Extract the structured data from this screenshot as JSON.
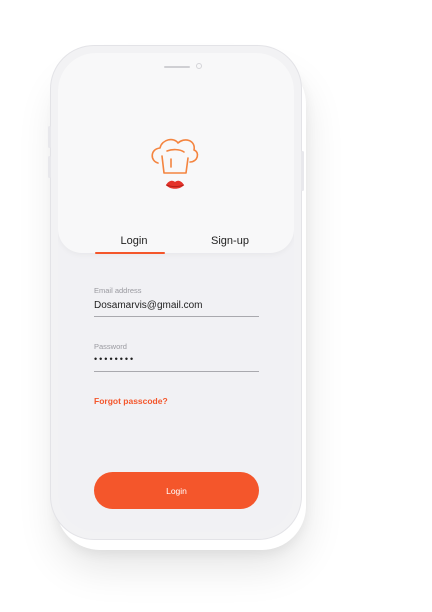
{
  "colors": {
    "accent": "#f4562b",
    "screen_bg": "#f1f1f4",
    "card_bg": "#f8f8f9",
    "text": "#1f1f1f",
    "muted": "#9a9aa0"
  },
  "icons": {
    "logo": "chef-hat-lips-logo",
    "speaker": "speaker-grille",
    "camera": "front-camera"
  },
  "tabs": {
    "login": "Login",
    "signup": "Sign-up",
    "active": "login"
  },
  "form": {
    "email": {
      "label": "Email address",
      "value": "Dosamarvis@gmail.com"
    },
    "password": {
      "label": "Password",
      "value": "••••••••"
    },
    "forgot_link": "Forgot passcode?",
    "submit_label": "Login"
  }
}
